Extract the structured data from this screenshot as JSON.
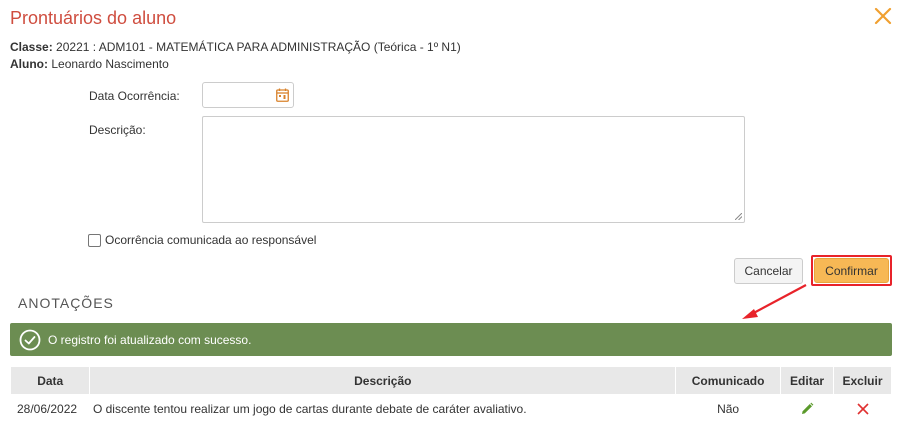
{
  "dialog": {
    "title": "Prontuários do aluno",
    "close_icon": "close-x-icon"
  },
  "info": {
    "classe_label": "Classe:",
    "classe_value": "20221 : ADM101 - MATEMÁTICA PARA ADMINISTRAÇÃO (Teórica - 1º N1)",
    "aluno_label": "Aluno:",
    "aluno_value": "Leonardo Nascimento"
  },
  "form": {
    "data_label": "Data Ocorrência:",
    "data_value": "",
    "descricao_label": "Descrição:",
    "descricao_value": "",
    "checkbox_label": "Ocorrência comunicada ao responsável",
    "checkbox_checked": false
  },
  "buttons": {
    "cancel": "Cancelar",
    "confirm": "Confirmar"
  },
  "annotations": {
    "section_title": "ANOTAÇÕES",
    "alert_message": "O registro foi atualizado com sucesso.",
    "columns": [
      "Data",
      "Descrição",
      "Comunicado",
      "Editar",
      "Excluir"
    ],
    "rows": [
      {
        "data": "28/06/2022",
        "descricao": "O discente tentou realizar um jogo de cartas durante debate de caráter avaliativo.",
        "comunicado": "Não"
      }
    ]
  },
  "colors": {
    "title": "#cf4d3f",
    "close": "#f0a030",
    "confirm_bg": "#f7b855",
    "highlight": "#e8232a",
    "alert_bg": "#6c8d52",
    "edit_icon": "#5a9a2a",
    "delete_icon": "#e03030"
  }
}
